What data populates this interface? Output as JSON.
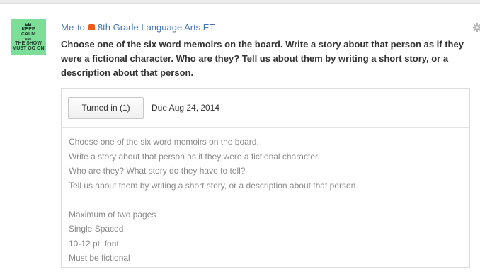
{
  "post": {
    "avatar": {
      "line1": "KEEP",
      "line2": "CALM",
      "line3": "AND",
      "line4": "THE SHOW",
      "line5": "MUST GO ON"
    },
    "author": "Me",
    "connector": "to",
    "class_name": "8th Grade Language Arts ET",
    "class_color": "#ec5b1a",
    "title": "Choose one of the six word memoirs on the board. Write a story about that person as if they were a fictional character. Who are they? Tell us about them by writing a short story, or a description about that person."
  },
  "assignment": {
    "turned_in_label": "Turned in (1)",
    "due": "Due Aug 24, 2014",
    "description": [
      "Choose one of the six word memoirs on the board.",
      "Write a story about that person as if they were a fictional character.",
      "Who are they? What story do they have to tell?",
      "Tell us about them by writing a short story, or a description about that person."
    ],
    "requirements": [
      "Maximum of two pages",
      "Single Spaced",
      "10-12 pt. font",
      "Must be fictional"
    ]
  },
  "colors": {
    "link": "#4274b8",
    "avatar_bg": "#7dde9a",
    "description_text": "#8a8a8a"
  },
  "icons": {
    "crown": "crown-icon",
    "settings": "gear-icon"
  }
}
